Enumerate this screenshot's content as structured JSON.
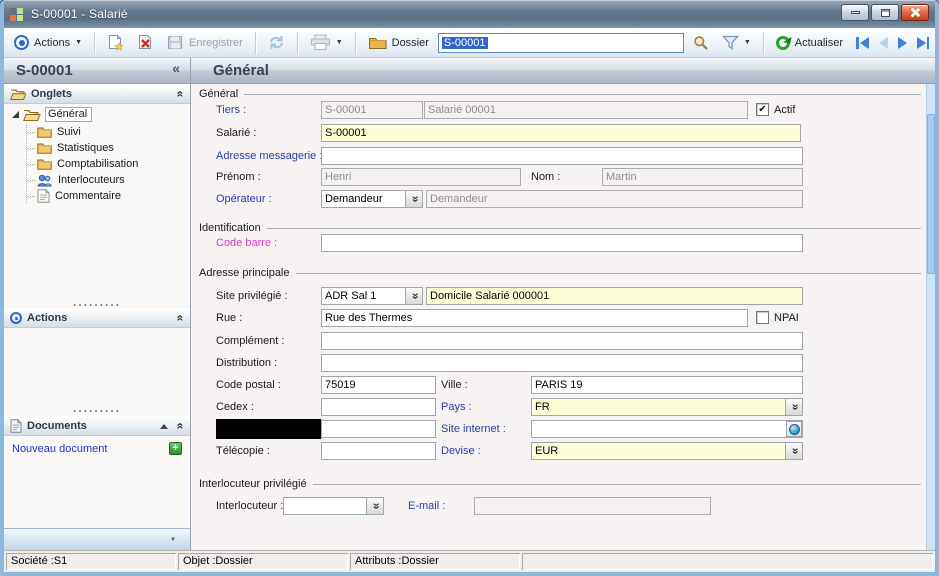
{
  "window": {
    "title": "S-00001 -  Salarié"
  },
  "toolbar": {
    "actions": "Actions",
    "enregistrer": "Enregistrer",
    "dossier": "Dossier",
    "search_value": "S-00001",
    "actualiser": "Actualiser"
  },
  "sidebar": {
    "header": "S-00001",
    "onglets": {
      "title": "Onglets",
      "root": "Général",
      "items": [
        {
          "label": "Suivi",
          "icon": "folder-icon"
        },
        {
          "label": "Statistiques",
          "icon": "folder-icon"
        },
        {
          "label": "Comptabilisation",
          "icon": "folder-icon"
        },
        {
          "label": "Interlocuteurs",
          "icon": "people-icon"
        },
        {
          "label": "Commentaire",
          "icon": "note-icon"
        }
      ]
    },
    "actions_panel": {
      "title": "Actions"
    },
    "documents_panel": {
      "title": "Documents",
      "new_document": "Nouveau document"
    }
  },
  "main": {
    "page_title": "Général",
    "general": {
      "legend": "Général",
      "tiers_label": "Tiers :",
      "tiers_code": "S-00001",
      "tiers_name": "Salarié 00001",
      "actif": "Actif",
      "salarie_label": "Salarié :",
      "salarie_value": "S-00001",
      "adresse_messagerie_label": "Adresse messagerie :",
      "prenom_label": "Prénom :",
      "prenom_value": "Henri",
      "nom_label": "Nom :",
      "nom_value": "Martin",
      "operateur_label": "Opérateur :",
      "operateur_value": "Demandeur",
      "operateur_desc": "Demandeur"
    },
    "identification": {
      "legend": "Identification",
      "code_barre_label": "Code barre :"
    },
    "adresse": {
      "legend": "Adresse principale",
      "site_label": "Site privilégié :",
      "site_value": "ADR Sal 1",
      "site_desc": "Domicile Salarié 000001",
      "rue_label": "Rue :",
      "rue_value": "Rue des Thermes",
      "npai": "NPAI",
      "complement_label": "Complément :",
      "distribution_label": "Distribution :",
      "code_postal_label": "Code postal  :",
      "code_postal_value": "75019",
      "ville_label": "Ville :",
      "ville_value": "PARIS 19",
      "cedex_label": "Cedex :",
      "pays_label": "Pays :",
      "pays_value": "FR",
      "site_internet_label": "Site internet :",
      "telecopie_label": "Télécopie  :",
      "devise_label": "Devise :",
      "devise_value": "EUR"
    },
    "interlocuteur": {
      "legend": "Interlocuteur privilégié",
      "interlocuteur_label": "Interlocuteur :",
      "email_label": "E-mail :"
    }
  },
  "statusbar": {
    "societe": "Société :S1",
    "objet": "Objet :Dossier",
    "attributs": "Attributs :Dossier"
  },
  "icons": {
    "collapse": "«",
    "check": "✔",
    "dots": ".........",
    "caret": "▼"
  },
  "colors": {
    "required_field_bg": "#FFFFD6",
    "label_blue": "#2B3CA8",
    "label_magenta": "#D93BC8",
    "selection_bg": "#3167C6",
    "titlebar": "#5C7184",
    "window_border": "#8FB8DF"
  }
}
